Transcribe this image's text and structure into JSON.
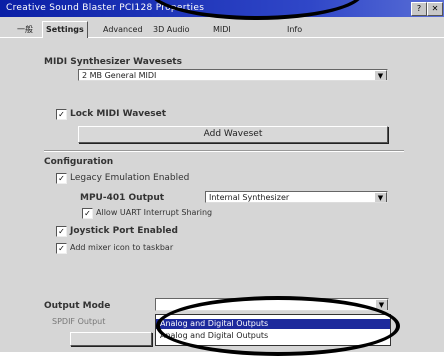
{
  "window": {
    "title": "Creative Sound Blaster PCI128 Properties",
    "help_label": "?",
    "close_label": "✕"
  },
  "tabs": [
    {
      "label": "一般"
    },
    {
      "label": "Settings"
    },
    {
      "label": "Advanced"
    },
    {
      "label": "3D Audio"
    },
    {
      "label": "MIDI"
    },
    {
      "label": "Info"
    }
  ],
  "midi": {
    "section_label": "MIDI Synthesizer Wavesets",
    "waveset_value": "2 MB General MIDI",
    "lock_label": "Lock MIDI Waveset",
    "lock_checked": true,
    "add_button": "Add Waveset"
  },
  "configuration": {
    "section_label": "Configuration",
    "legacy_label": "Legacy Emulation Enabled",
    "legacy_checked": true,
    "mpu_label": "MPU-401 Output",
    "mpu_value": "Internal Synthesizer",
    "uart_label": "Allow UART Interrupt Sharing",
    "uart_checked": true,
    "joystick_label": "Joystick Port Enabled",
    "joystick_checked": true,
    "mixer_label": "Add mixer icon to taskbar",
    "mixer_checked": true
  },
  "output": {
    "mode_label": "Output Mode",
    "mode_value": "",
    "sub_label": "SPDIF Output",
    "options": [
      "Analog and Digital Outputs",
      "Analog and Digital Outputs"
    ]
  },
  "glyphs": {
    "check": "✓",
    "arrow": "▼"
  }
}
